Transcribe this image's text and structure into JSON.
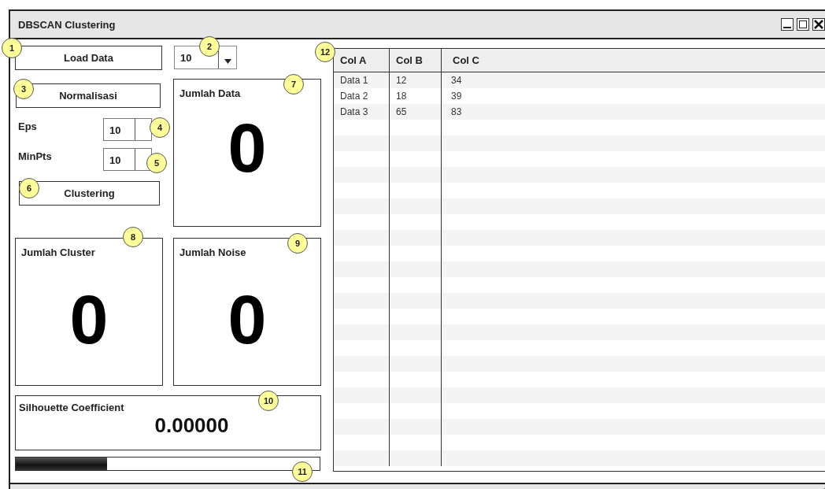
{
  "window": {
    "title": "DBSCAN Clustering"
  },
  "load_button": {
    "label": "Load Data"
  },
  "count_spinner": {
    "value": "10"
  },
  "normalize_button": {
    "label": "Normalisasi"
  },
  "params": [
    {
      "label": "Eps",
      "value": "10"
    },
    {
      "label": "MinPts",
      "value": "10"
    }
  ],
  "cluster_button": {
    "label": "Clustering"
  },
  "stats": [
    {
      "label": "Jumlah Data",
      "value": "0"
    },
    {
      "label": "Jumlah Cluster",
      "value": "0"
    },
    {
      "label": "Jumlah Noise",
      "value": "0"
    }
  ],
  "silhouette": {
    "label": "Silhouette Coefficient",
    "value": "0.00000"
  },
  "progress": {
    "level": 0.3
  },
  "table": {
    "columns": [
      "Col A",
      "Col B",
      "Col C"
    ],
    "rows": [
      [
        "Data 1",
        "12",
        "34"
      ],
      [
        "Data 2",
        "18",
        "39"
      ],
      [
        "Data 3",
        "65",
        "83"
      ]
    ]
  },
  "callouts": [
    "1",
    "2",
    "3",
    "4",
    "5",
    "6",
    "7",
    "8",
    "9",
    "10",
    "11",
    "12"
  ]
}
